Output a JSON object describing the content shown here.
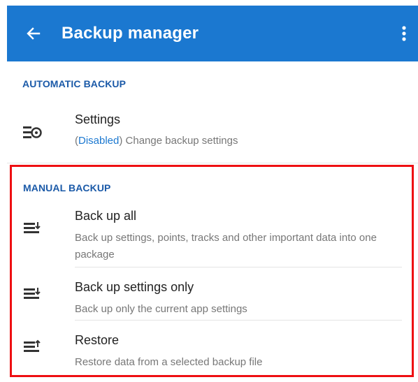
{
  "app_bar": {
    "title": "Backup manager",
    "background": "#1b78d0",
    "back_icon": "arrow-left-icon",
    "menu_icon": "more-vert-icon"
  },
  "automatic_backup": {
    "header": "AUTOMATIC BACKUP",
    "settings": {
      "title": "Settings",
      "status": "Disabled",
      "description": " Change backup settings",
      "icon": "settings-sliders-icon"
    }
  },
  "manual_backup": {
    "header": "MANUAL BACKUP",
    "highlight_color": "#ee0f12",
    "items": [
      {
        "title": "Back up all",
        "description": "Back up settings, points, tracks and other important data into one package",
        "icon": "list-download-icon"
      },
      {
        "title": "Back up settings only",
        "description": "Back up only the current app settings",
        "icon": "list-download-icon"
      },
      {
        "title": "Restore",
        "description": "Restore data from a selected backup file",
        "icon": "list-upload-icon"
      }
    ]
  }
}
